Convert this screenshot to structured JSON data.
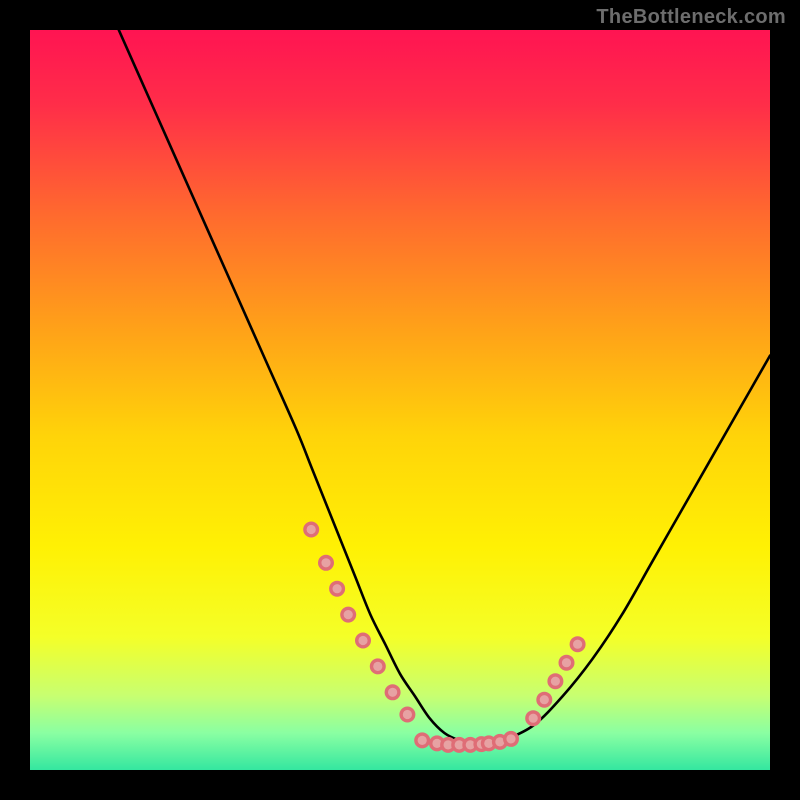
{
  "watermark": "TheBottleneck.com",
  "chart_data": {
    "type": "line",
    "title": "",
    "xlabel": "",
    "ylabel": "",
    "xlim": [
      0,
      100
    ],
    "ylim": [
      0,
      100
    ],
    "grid": false,
    "legend": false,
    "series": [
      {
        "name": "bottleneck-curve",
        "color": "#000000",
        "x": [
          12,
          16,
          20,
          24,
          28,
          32,
          36,
          38,
          40,
          42,
          44,
          46,
          48,
          50,
          52,
          54,
          56,
          58,
          60,
          62,
          64,
          68,
          72,
          76,
          80,
          84,
          88,
          92,
          96,
          100
        ],
        "y": [
          100,
          91,
          82,
          73,
          64,
          55,
          46,
          41,
          36,
          31,
          26,
          21,
          17,
          13,
          10,
          7,
          5,
          4,
          3.5,
          3.5,
          4,
          6,
          10,
          15,
          21,
          28,
          35,
          42,
          49,
          56
        ]
      },
      {
        "name": "left-markers",
        "type": "scatter",
        "color": "#df6d76",
        "x": [
          38,
          40,
          41.5,
          43,
          45,
          47,
          49,
          51
        ],
        "y": [
          32.5,
          28,
          24.5,
          21,
          17.5,
          14,
          10.5,
          7.5
        ]
      },
      {
        "name": "bottom-markers",
        "type": "scatter",
        "color": "#df6d76",
        "x": [
          53,
          55,
          56.5,
          58,
          59.5,
          61,
          62,
          63.5,
          65
        ],
        "y": [
          4.0,
          3.6,
          3.4,
          3.4,
          3.4,
          3.5,
          3.6,
          3.8,
          4.2
        ]
      },
      {
        "name": "right-markers",
        "type": "scatter",
        "color": "#df6d76",
        "x": [
          68,
          69.5,
          71,
          72.5,
          74
        ],
        "y": [
          7,
          9.5,
          12,
          14.5,
          17
        ]
      }
    ],
    "gradient_stops": [
      {
        "offset": 0.0,
        "color": "#ff1452"
      },
      {
        "offset": 0.1,
        "color": "#ff2d49"
      },
      {
        "offset": 0.25,
        "color": "#ff6a2e"
      },
      {
        "offset": 0.4,
        "color": "#ffa019"
      },
      {
        "offset": 0.55,
        "color": "#ffd409"
      },
      {
        "offset": 0.7,
        "color": "#fff104"
      },
      {
        "offset": 0.82,
        "color": "#f4ff28"
      },
      {
        "offset": 0.9,
        "color": "#c7ff71"
      },
      {
        "offset": 0.95,
        "color": "#8affa2"
      },
      {
        "offset": 1.0,
        "color": "#34e7a0"
      }
    ],
    "marker_style": {
      "radius_outer": 8,
      "radius_inner": 4.6,
      "fill_outer": "#df6d76",
      "fill_inner": "#e7a2a3"
    }
  }
}
